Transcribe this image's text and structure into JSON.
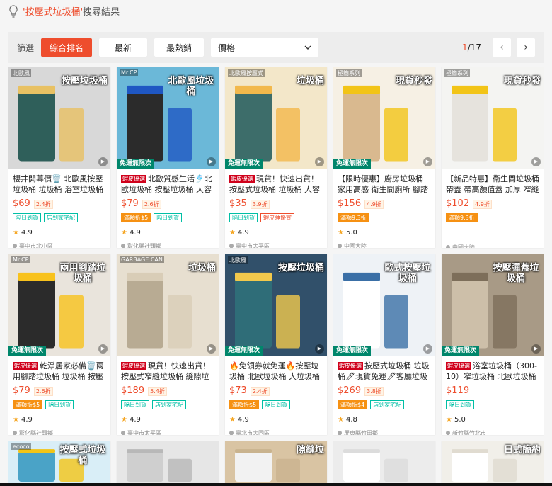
{
  "header": {
    "quote_open": "'",
    "keyword": "按壓式垃圾桶",
    "quote_close": "'",
    "suffix": "搜尋結果",
    "icon": "lightbulb-icon"
  },
  "sortbar": {
    "label": "篩選",
    "relevance": "綜合排名",
    "latest": "最新",
    "top_sales": "最熱銷",
    "price": "價格",
    "page_current": "1",
    "page_total": "/17"
  },
  "colors": {
    "accent": "#ee4d2d",
    "promo_green": "#00866b",
    "tag_teal": "#00bfa5",
    "tag_orange": "#f69113"
  },
  "products": [
    {
      "badge": "",
      "title": "櫻井開幕價🗑️ 北歐風按壓垃圾桶 垃圾桶 浴室垃圾桶",
      "price": "$69",
      "discount": "2.4折",
      "tags": [
        {
          "text": "隔日到貨",
          "style": "teal"
        },
        {
          "text": "店到家宅配",
          "style": "teal"
        }
      ],
      "rating": "4.9",
      "location": "臺中市北屯區",
      "promo": "",
      "img_text": "按壓垃圾桶",
      "img_sub": "北歐風",
      "palette": [
        "#d8d8d8",
        "#2f5f5a",
        "#e8c163"
      ]
    },
    {
      "badge": "蝦皮優選",
      "title": "北歐質感生活🎐北歐垃圾桶 按壓垃圾桶 大容量",
      "price": "$79",
      "discount": "2.6折",
      "tags": [
        {
          "text": "滿額折$5",
          "style": "orange"
        },
        {
          "text": "隔日到貨",
          "style": "teal"
        }
      ],
      "rating": "4.9",
      "location": "彰化縣社頭鄉",
      "promo": "免運無限次",
      "img_text": "北歐風垃圾桶",
      "img_sub": "Mr.CP",
      "palette": [
        "#6bb8d8",
        "#2b2b2b",
        "#1f57c3"
      ]
    },
    {
      "badge": "蝦皮優選",
      "title": "現貨！快速出貨！按壓式垃圾桶 垃圾桶 大容量",
      "price": "$35",
      "discount": "3.9折",
      "tags": [
        {
          "text": "隔日到貨",
          "style": "teal"
        },
        {
          "text": "蝦皮睡優宣",
          "style": "red"
        }
      ],
      "rating": "4.9",
      "location": "臺中市太平區",
      "promo": "免運無限次",
      "img_text": "垃圾桶",
      "img_sub": "北歐風按壓式",
      "palette": [
        "#f3e7c9",
        "#3d6d6a",
        "#f2b84b"
      ]
    },
    {
      "badge": "",
      "title": "【限時優惠】廚房垃圾桶 家用高感 衛生間廁所 腳踏式",
      "price": "$156",
      "discount": "4.9折",
      "tags": [
        {
          "text": "滿額9.3折",
          "style": "orange"
        }
      ],
      "rating": "5.0",
      "location": "中國大陸",
      "promo": "免運無限次",
      "img_text": "現貨秒發",
      "img_sub": "極簡系列",
      "palette": [
        "#f6f0e4",
        "#d9b98f",
        "#f2c417"
      ]
    },
    {
      "badge": "",
      "title": "【新品特惠】衛生間垃圾桶 帶蓋 帶高顏值蓋 加厚 窄縫",
      "price": "$102",
      "discount": "4.9折",
      "tags": [
        {
          "text": "滿額9.3折",
          "style": "orange"
        }
      ],
      "rating": "",
      "location": "中國大陸",
      "promo": "",
      "img_text": "現貨秒發",
      "img_sub": "極簡系列",
      "palette": [
        "#f4f4f2",
        "#e6e3dd",
        "#f2c417"
      ]
    },
    {
      "badge": "蝦皮優選",
      "title": "乾淨居家必備🗑️兩用腳踏垃圾桶 垃圾桶 按壓式",
      "price": "$79",
      "discount": "2.6折",
      "tags": [
        {
          "text": "滿額折$5",
          "style": "orange"
        },
        {
          "text": "隔日到貨",
          "style": "teal"
        }
      ],
      "rating": "4.9",
      "location": "彰化縣社頭鄉",
      "promo": "免運無限次",
      "img_text": "兩用腳踏垃圾桶",
      "img_sub": "Mr.CP",
      "palette": [
        "#e9e4dc",
        "#2b2b2b",
        "#f8c21c"
      ]
    },
    {
      "badge": "蝦皮優選",
      "title": "現貨！快速出貨！按壓式窄縫垃圾桶 縫隙垃圾桶",
      "price": "$189",
      "discount": "5.4折",
      "tags": [
        {
          "text": "隔日到貨",
          "style": "teal"
        },
        {
          "text": "店到家宅配",
          "style": "teal"
        }
      ],
      "rating": "4.9",
      "location": "臺中市太平區",
      "promo": "",
      "img_text": "垃圾桶",
      "img_sub": "GARBAGE CAN",
      "palette": [
        "#e7dfd0",
        "#b8ab93",
        "#d9cdb7"
      ]
    },
    {
      "badge": "",
      "title": "🔥免領券就免運🔥按壓垃圾桶 北歐垃圾桶 大垃圾桶",
      "price": "$73",
      "discount": "2.4折",
      "tags": [
        {
          "text": "滿額折$5",
          "style": "orange"
        },
        {
          "text": "隔日到貨",
          "style": "teal"
        }
      ],
      "rating": "4.9",
      "location": "臺北市大同區",
      "promo": "免運無限次",
      "img_text": "按壓垃圾桶",
      "img_sub": "北歐風",
      "palette": [
        "#31506a",
        "#2f6d78",
        "#f2c94c"
      ]
    },
    {
      "badge": "蝦皮優選",
      "title": "按壓式垃圾桶 垃圾桶🖊現貨免運🖊客廳垃圾桶",
      "price": "$269",
      "discount": "3.8折",
      "tags": [
        {
          "text": "滿額折$4",
          "style": "orange"
        },
        {
          "text": "店到家宅配",
          "style": "teal"
        }
      ],
      "rating": "4.8",
      "location": "屏東縣竹田鄉",
      "promo": "免運無限次",
      "img_text": "歐式按壓垃圾桶",
      "img_sub": "",
      "palette": [
        "#eef2f6",
        "#ffffff",
        "#3a6fa6"
      ]
    },
    {
      "badge": "蝦皮優選",
      "title": "浴室垃圾桶（300-10）窄垃圾桶 北歐垃圾桶",
      "price": "$119",
      "discount": "",
      "tags": [
        {
          "text": "隔日到貨",
          "style": "teal"
        }
      ],
      "rating": "5.0",
      "location": "新竹縣竹北市",
      "promo": "免運無限次",
      "img_text": "按壓彈蓋垃圾桶",
      "img_sub": "",
      "palette": [
        "#a89a86",
        "#cdbfa9",
        "#7d6e5a"
      ]
    }
  ],
  "third_row": [
    {
      "img_text": "按壓式垃圾桶",
      "img_sub": "ecoco",
      "palette": [
        "#d9eef7",
        "#4aa3c7",
        "#f2c417"
      ]
    },
    {
      "img_text": "",
      "img_sub": "",
      "palette": [
        "#e6e6e6",
        "#cfcfcf",
        "#b8b8b8"
      ]
    },
    {
      "img_text": "隙縫垃",
      "img_sub": "",
      "palette": [
        "#d9c4a3",
        "#f2f2f2",
        "#c9b38e"
      ]
    },
    {
      "img_text": "",
      "img_sub": "",
      "palette": [
        "#ececec",
        "#ffffff",
        "#dcdcdc"
      ]
    },
    {
      "img_text": "日式簡約",
      "img_sub": "",
      "palette": [
        "#f1efe9",
        "#ffffff",
        "#e0dbd0"
      ]
    },
    {
      "img_text": "",
      "img_sub": "",
      "palette": [
        "#1c2f48",
        "#f2b441",
        "#2b4a6a"
      ]
    }
  ]
}
